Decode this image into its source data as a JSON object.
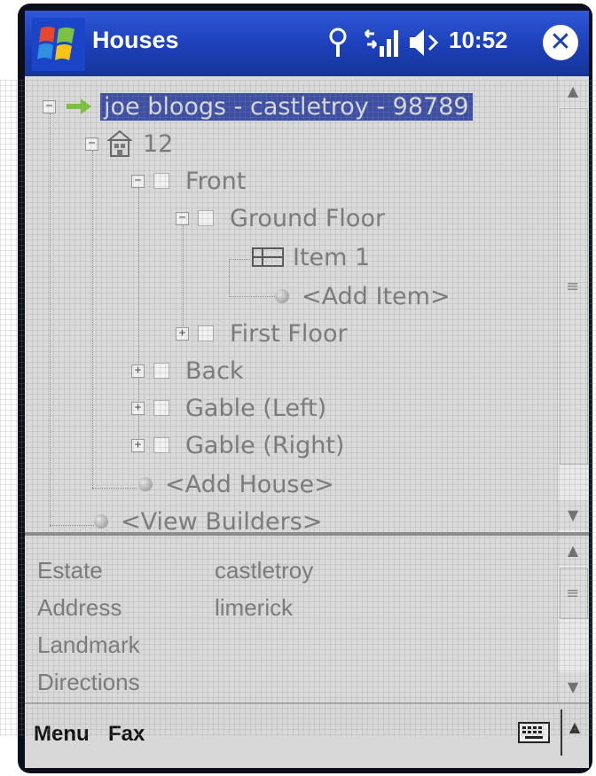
{
  "titlebar": {
    "title": "Houses",
    "clock": "10:52",
    "icons": [
      "windows-start-icon",
      "connectivity-icon",
      "signal-icon",
      "speaker-icon",
      "close-icon"
    ]
  },
  "tree": {
    "nodes": [
      {
        "label": "joe bloogs - castletroy - 98789",
        "icon": "green-arrow-icon",
        "selected": true
      },
      {
        "label": "12",
        "icon": "house-icon"
      },
      {
        "label": "Front",
        "icon": "checkbox"
      },
      {
        "label": "Ground Floor",
        "icon": "checkbox"
      },
      {
        "label": "Item 1",
        "icon": "grid-icon"
      },
      {
        "label": "<Add Item>",
        "icon": "bullet"
      },
      {
        "label": "First Floor",
        "icon": "checkbox"
      },
      {
        "label": "Back",
        "icon": "checkbox"
      },
      {
        "label": "Gable (Left)",
        "icon": "checkbox"
      },
      {
        "label": "Gable (Right)",
        "icon": "checkbox"
      },
      {
        "label": "<Add House>",
        "icon": "bullet"
      },
      {
        "label": "<View Builders>",
        "icon": "bullet"
      }
    ]
  },
  "details": {
    "rows": [
      {
        "label": "Estate",
        "value": "castletroy"
      },
      {
        "label": "Address",
        "value": "limerick"
      },
      {
        "label": "Landmark",
        "value": ""
      },
      {
        "label": "Directions",
        "value": ""
      }
    ]
  },
  "menubar": {
    "menu_label": "Menu",
    "fax_label": "Fax"
  },
  "colors": {
    "titlebar": "#1c3fb8",
    "selection": "#3c4ea6",
    "pane": "#dadada",
    "text": "#7a7a7a"
  }
}
